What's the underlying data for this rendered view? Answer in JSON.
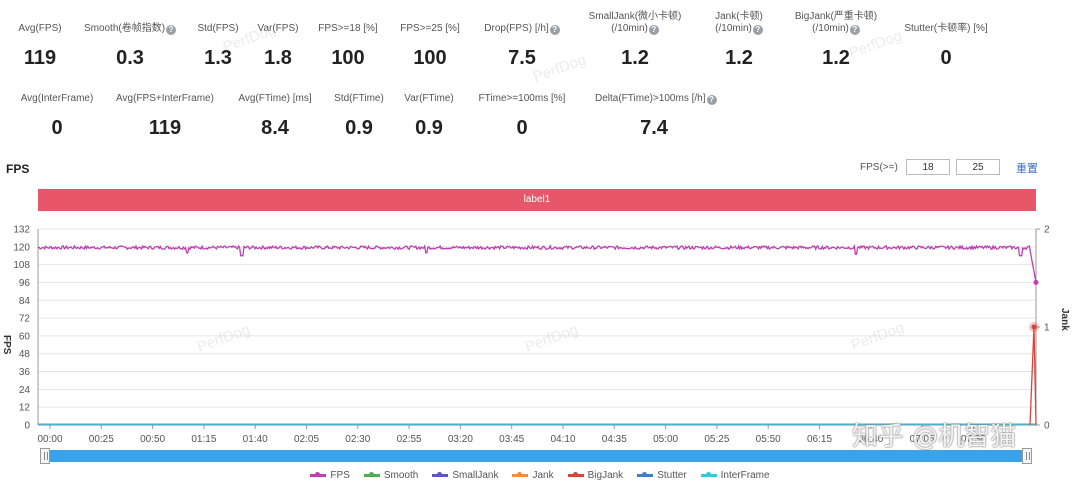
{
  "stats_row1": [
    {
      "label": "Avg(FPS)",
      "value": "119",
      "help": false
    },
    {
      "label": "Smooth(卷帧指数)",
      "value": "0.3",
      "help": true
    },
    {
      "label": "Std(FPS)",
      "value": "1.3",
      "help": false
    },
    {
      "label": "Var(FPS)",
      "value": "1.8",
      "help": false
    },
    {
      "label": "FPS>=18 [%]",
      "value": "100",
      "help": false
    },
    {
      "label": "FPS>=25 [%]",
      "value": "100",
      "help": false
    },
    {
      "label": "Drop(FPS) [/h]",
      "value": "7.5",
      "help": true
    },
    {
      "label": "SmallJank(微小卡顿)",
      "label2": "(/10min)",
      "value": "1.2",
      "help": true
    },
    {
      "label": "Jank(卡顿)",
      "label2": "(/10min)",
      "value": "1.2",
      "help": true
    },
    {
      "label": "BigJank(严重卡顿)",
      "label2": "(/10min)",
      "value": "1.2",
      "help": true
    },
    {
      "label": "Stutter(卡顿率) [%]",
      "value": "0",
      "help": false
    }
  ],
  "stats_row2": [
    {
      "label": "Avg(InterFrame)",
      "value": "0",
      "help": false
    },
    {
      "label": "Avg(FPS+InterFrame)",
      "value": "119",
      "help": false
    },
    {
      "label": "Avg(FTime) [ms]",
      "value": "8.4",
      "help": false
    },
    {
      "label": "Std(FTime)",
      "value": "0.9",
      "help": false
    },
    {
      "label": "Var(FTime)",
      "value": "0.9",
      "help": false
    },
    {
      "label": "FTime>=100ms [%]",
      "value": "0",
      "help": false
    },
    {
      "label": "Delta(FTime)>100ms [/h]",
      "value": "7.4",
      "help": true
    }
  ],
  "chart_header": {
    "title": "FPS",
    "threshold_label": "FPS(>=)",
    "threshold1": "18",
    "threshold2": "25",
    "reset_label": "重置",
    "label_bar": "label1"
  },
  "chart_data": {
    "type": "line",
    "x_ticks": [
      "00:00",
      "00:25",
      "00:50",
      "01:15",
      "01:40",
      "02:05",
      "02:30",
      "02:55",
      "03:20",
      "03:45",
      "04:10",
      "04:35",
      "05:00",
      "05:25",
      "05:50",
      "06:15",
      "06:40",
      "07:05",
      "07:30"
    ],
    "y_ticks": [
      0,
      12,
      24,
      36,
      48,
      60,
      72,
      84,
      96,
      108,
      120,
      132
    ],
    "ylabel": "FPS",
    "ylim": [
      0,
      132
    ],
    "y2_ticks": [
      0,
      1,
      2
    ],
    "y2label": "Jank",
    "y2lim": [
      0,
      2
    ],
    "duration_seconds": 455,
    "series": [
      {
        "name": "FPS",
        "color": "#c13db0",
        "axis": "left",
        "baseline": 119.5,
        "end_values": [
          {
            "t": 453,
            "v": 112
          },
          {
            "t": 455,
            "v": 96
          }
        ],
        "dips": [
          {
            "t": 68,
            "v": 116
          },
          {
            "t": 93,
            "v": 114
          },
          {
            "t": 177,
            "v": 116
          },
          {
            "t": 373,
            "v": 115
          },
          {
            "t": 448,
            "v": 114
          }
        ]
      },
      {
        "name": "Smooth",
        "color": "#4caf50",
        "axis": "left",
        "baseline": 0.3
      },
      {
        "name": "SmallJank",
        "color": "#5b57b8",
        "axis": "right",
        "baseline": 0
      },
      {
        "name": "Jank",
        "color": "#e8904a",
        "axis": "right",
        "baseline": 0
      },
      {
        "name": "BigJank",
        "color": "#d9433b",
        "axis": "right",
        "baseline": 0,
        "spike": {
          "t": 455,
          "v": 1
        }
      },
      {
        "name": "Stutter",
        "color": "#3f7fd1",
        "axis": "right",
        "baseline": 0
      },
      {
        "name": "InterFrame",
        "color": "#3cc4d9",
        "axis": "left",
        "baseline": 0
      }
    ],
    "grid": true,
    "legend": "bottom"
  },
  "legend_items": [
    "FPS",
    "Smooth",
    "SmallJank",
    "Jank",
    "BigJank",
    "Stutter",
    "InterFrame"
  ],
  "watermark": "PerfDog",
  "corner_watermark": "知乎 @机智猫"
}
